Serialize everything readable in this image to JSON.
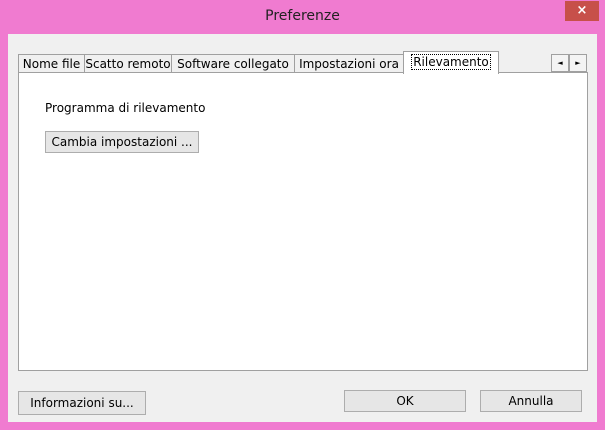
{
  "window": {
    "title": "Preferenze",
    "close_symbol": "×",
    "close_icon": "close-icon"
  },
  "tabs": [
    {
      "label": "Nome file",
      "active": false
    },
    {
      "label": "Scatto remoto",
      "active": false
    },
    {
      "label": "Software collegato",
      "active": false
    },
    {
      "label": "Impostazioni ora",
      "active": false
    },
    {
      "label": "Rilevamento",
      "active": true
    }
  ],
  "tab_scroll": {
    "left_symbol": "◄",
    "right_symbol": "►",
    "left_icon": "arrow-left-icon",
    "right_icon": "arrow-right-icon"
  },
  "panel": {
    "group_label": "Programma di rilevamento",
    "change_button": "Cambia impostazioni ..."
  },
  "footer": {
    "info_button": "Informazioni su...",
    "ok_button": "OK",
    "cancel_button": "Annulla"
  },
  "colors": {
    "frame": "#f07bd0",
    "close": "#c7504a",
    "client": "#f0f0f0",
    "panel": "#ffffff"
  }
}
